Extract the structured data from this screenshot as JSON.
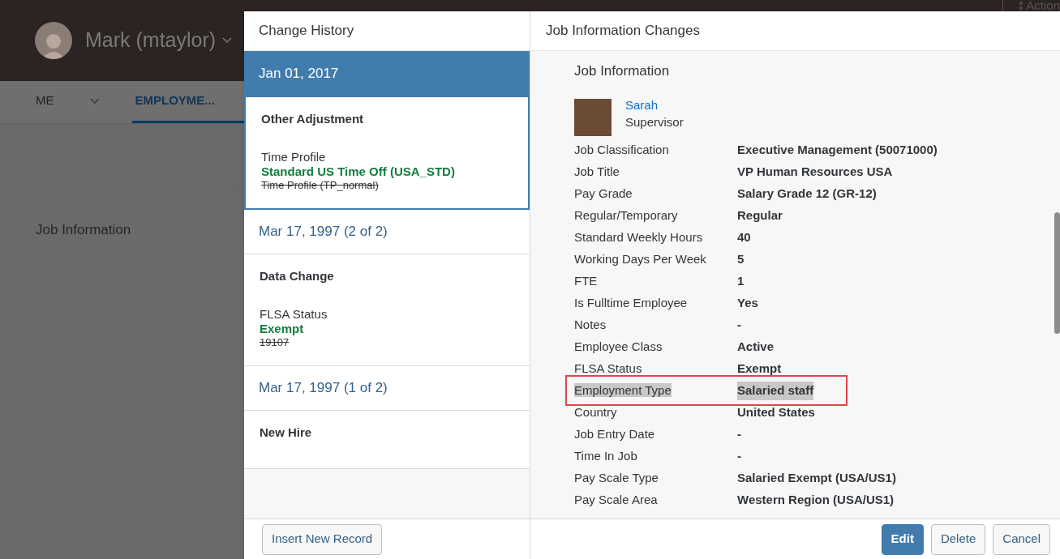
{
  "background": {
    "user_name": "Mark (mtaylor)",
    "action_label": "Action",
    "nav_tabs": [
      {
        "label": "ME",
        "selected": false
      },
      {
        "label": "EMPLOYME...",
        "selected": true
      }
    ],
    "section_title": "Job Information"
  },
  "dialog": {
    "history_title": "Change History",
    "details_title": "Job Information Changes",
    "history": [
      {
        "kind": "date",
        "label": "Jan 01, 2017",
        "selected": true
      },
      {
        "kind": "event",
        "title": "Other Adjustment",
        "selected": true,
        "changes": [
          {
            "field": "Time Profile",
            "new": "Standard US Time Off (USA_STD)",
            "old": "Time Profile (TP_normal)"
          }
        ]
      },
      {
        "kind": "date",
        "label": "Mar 17, 1997 (2 of 2)",
        "selected": false
      },
      {
        "kind": "event",
        "title": "Data Change",
        "selected": false,
        "changes": [
          {
            "field": "FLSA Status",
            "new": "Exempt",
            "old": "19107"
          }
        ]
      },
      {
        "kind": "date",
        "label": "Mar 17, 1997 (1 of 2)",
        "selected": false
      },
      {
        "kind": "event",
        "title": "New Hire",
        "selected": false
      }
    ],
    "details": {
      "section_title": "Job Information",
      "supervisor": {
        "name": "Sarah",
        "role": "Supervisor"
      },
      "fields": [
        {
          "label": "Job Classification",
          "value": "Executive Management (50071000)",
          "highlighted": false
        },
        {
          "label": "Job Title",
          "value": "VP Human Resources USA",
          "highlighted": false
        },
        {
          "label": "Pay Grade",
          "value": "Salary Grade 12 (GR-12)",
          "highlighted": false
        },
        {
          "label": "Regular/Temporary",
          "value": "Regular",
          "highlighted": false
        },
        {
          "label": "Standard Weekly Hours",
          "value": "40",
          "highlighted": false
        },
        {
          "label": "Working Days Per Week",
          "value": "5",
          "highlighted": false
        },
        {
          "label": "FTE",
          "value": "1",
          "highlighted": false
        },
        {
          "label": "Is Fulltime Employee",
          "value": "Yes",
          "highlighted": false
        },
        {
          "label": "Notes",
          "value": "-",
          "highlighted": false
        },
        {
          "label": "Employee Class",
          "value": "Active",
          "highlighted": false
        },
        {
          "label": "FLSA Status",
          "value": "Exempt",
          "highlighted": false
        },
        {
          "label": "Employment Type",
          "value": "Salaried staff",
          "highlighted": true
        },
        {
          "label": "Country",
          "value": "United States",
          "highlighted": false
        },
        {
          "label": "Job Entry Date",
          "value": "-",
          "highlighted": false
        },
        {
          "label": "Time In Job",
          "value": "-",
          "highlighted": false
        },
        {
          "label": "Pay Scale Type",
          "value": "Salaried Exempt (USA/US1)",
          "highlighted": false
        },
        {
          "label": "Pay Scale Area",
          "value": "Western Region (USA/US1)",
          "highlighted": false
        }
      ]
    },
    "left_button": "Insert New Record",
    "buttons": [
      {
        "label": "Edit",
        "kind": "primary"
      },
      {
        "label": "Delete",
        "kind": "default"
      },
      {
        "label": "Cancel",
        "kind": "default"
      }
    ]
  }
}
